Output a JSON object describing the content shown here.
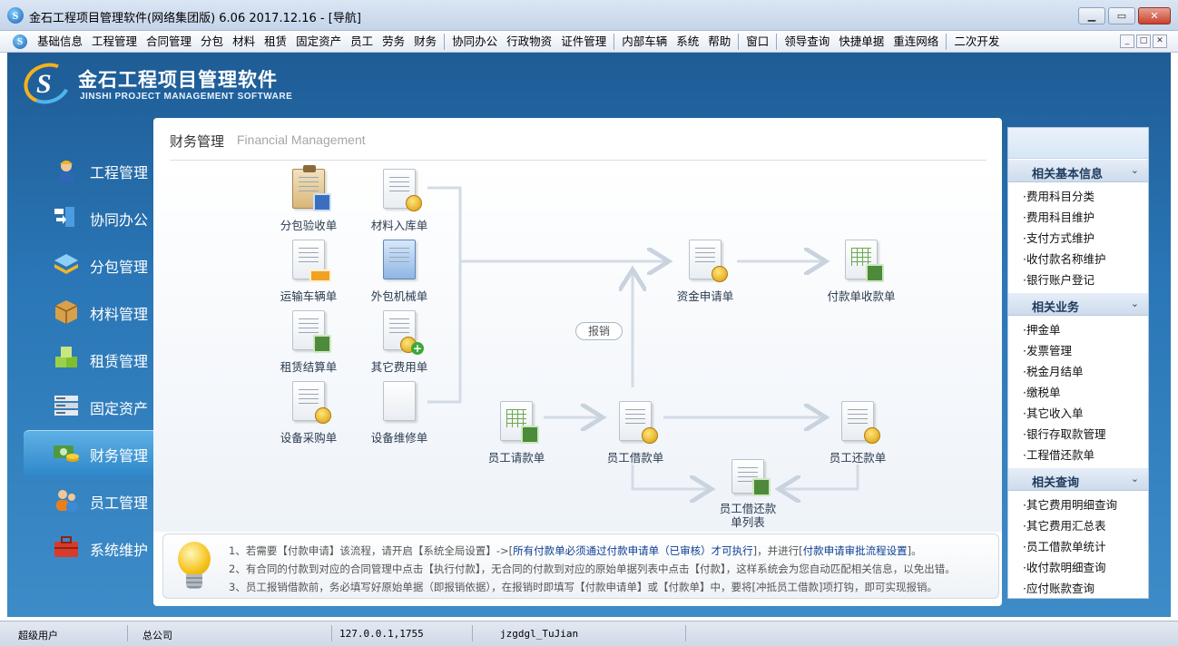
{
  "window": {
    "title": "金石工程项目管理软件(网络集团版) 6.06  2017.12.16 - [导航]",
    "minimize": "▁",
    "restore": "▭",
    "close": "✕"
  },
  "menu": {
    "items": [
      "基础信息",
      "工程管理",
      "合同管理",
      "分包",
      "材料",
      "租赁",
      "固定资产",
      "员工",
      "劳务",
      "财务",
      "协同办公",
      "行政物资",
      "证件管理",
      "内部车辆",
      "系统",
      "帮助",
      "窗口",
      "领导查询",
      "快捷单据",
      "重连网络",
      "二次开发"
    ],
    "mdi": [
      "_",
      "□",
      "✕"
    ]
  },
  "logo": {
    "cn": "金石工程项目管理软件",
    "en": "JINSHI PROJECT MANAGEMENT SOFTWARE"
  },
  "nav": {
    "items": [
      "工程管理",
      "协同办公",
      "分包管理",
      "材料管理",
      "租赁管理",
      "固定资产",
      "财务管理",
      "员工管理",
      "系统维护"
    ],
    "active": "财务管理"
  },
  "panel": {
    "title": "财务管理",
    "subtitle": "Financial Management",
    "nodes": {
      "fenbao_yanshou": "分包验收单",
      "cailiao_ruku": "材料入库单",
      "yunshu_cheliang": "运输车辆单",
      "waibao_jixie": "外包机械单",
      "zulin_jiesuan": "租赁结算单",
      "qita_feiyong": "其它费用单",
      "shebei_caigou": "设备采购单",
      "shebei_weixiu": "设备维修单",
      "zijin_shenqing": "资金申请单",
      "fukuan_shoukuan": "付款单收款单",
      "yuangong_qingkuan": "员工请款单",
      "yuangong_jiekuan": "员工借款单",
      "yuangong_huankuan": "员工还款单",
      "jiehuan_line1": "员工借还款",
      "jiehuan_line2": "单列表"
    },
    "reimburse": "报销",
    "tips": {
      "line1_a": "1、若需要【付款申请】该流程，请开启【系统全局设置】->[",
      "line1_b": "所有付款单必须通过付款申请单（已审核）才可执行",
      "line1_c": "]，并进行[",
      "line1_d": "付款申请审批流程设置",
      "line1_e": "]。",
      "line2": "2、有合同的付款到对应的合同管理中点击【执行付款】，无合同的付款到对应的原始单据列表中点击【付款】，这样系统会为您自动匹配相关信息，以免出错。",
      "line3": "3、员工报销借款前，务必填写好原始单据（即报销依据），在报销时即填写【付款申请单】或【付款单】中，要将[冲抵员工借款]项打钩，即可实现报销。"
    }
  },
  "right": {
    "sections": [
      {
        "title": "相关基本信息",
        "items": [
          "·费用科目分类",
          "·费用科目维护",
          "·支付方式维护",
          "·收付款名称维护",
          "·银行账户登记"
        ]
      },
      {
        "title": "相关业务",
        "items": [
          "·押金单",
          "·发票管理",
          "·税金月结单",
          "·缴税单",
          "·其它收入单",
          "·银行存取款管理",
          "·工程借还款单"
        ]
      },
      {
        "title": "相关查询",
        "items": [
          "·其它费用明细查询",
          "·其它费用汇总表",
          "·员工借款单统计",
          "·收付款明细查询",
          "·应付账款查询"
        ]
      }
    ],
    "chevron": "⌄"
  },
  "status": {
    "user": "超级用户",
    "company": "总公司",
    "ip": "127.0.0.1,1755",
    "db": "jzgdgl_TuJian"
  }
}
